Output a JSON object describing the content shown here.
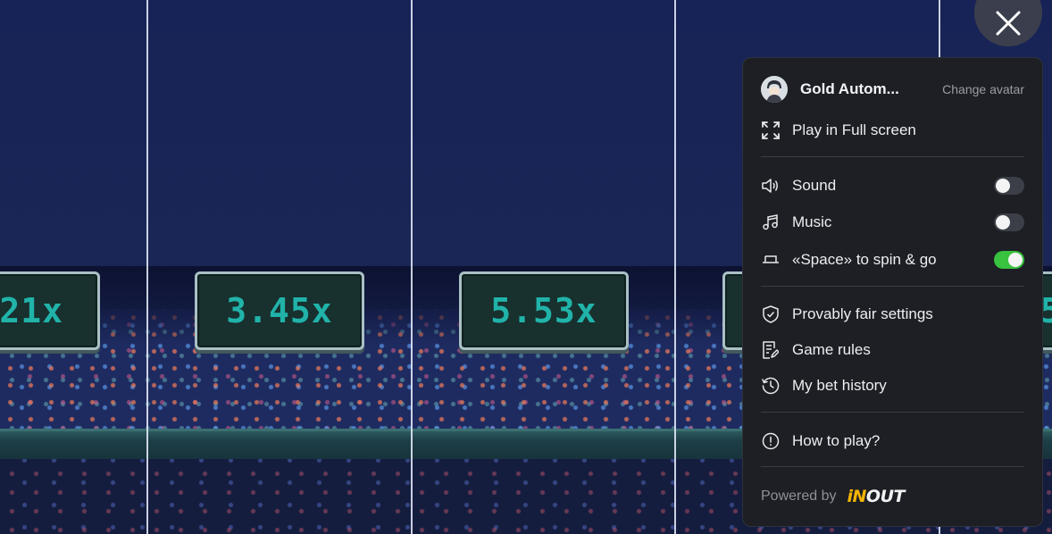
{
  "game": {
    "multipliers": [
      "21x",
      "3.45x",
      "5.53x",
      "",
      "5"
    ]
  },
  "menu": {
    "username": "Gold Autom...",
    "change_avatar": "Change avatar",
    "fullscreen_label": "Play in Full screen",
    "sound_label": "Sound",
    "sound_on": false,
    "music_label": "Music",
    "music_on": false,
    "space_label": "«Space» to spin & go",
    "space_on": true,
    "provably_fair_label": "Provably fair settings",
    "game_rules_label": "Game rules",
    "bet_history_label": "My bet history",
    "how_to_play_label": "How to play?",
    "powered_by": "Powered by",
    "brand_in": "iN",
    "brand_out": "OUT"
  },
  "colors": {
    "toggle_on": "#39c23f",
    "multiplier_text": "#21b3a9",
    "brand_accent": "#f4b400"
  }
}
